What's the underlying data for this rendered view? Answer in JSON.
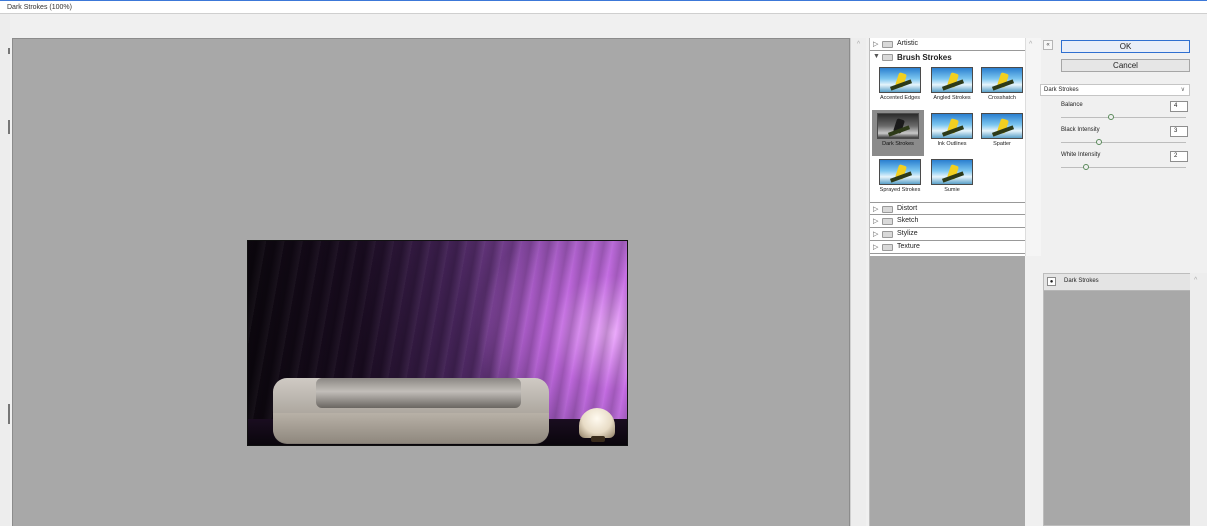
{
  "window": {
    "title": "Dark Strokes (100%)"
  },
  "filter_gallery": {
    "categories_top": [
      {
        "name": "Artistic",
        "expanded": false
      }
    ],
    "open_category": {
      "name": "Brush Strokes",
      "thumbnails": [
        {
          "label": "Accented Edges",
          "selected": false
        },
        {
          "label": "Angled Strokes",
          "selected": false
        },
        {
          "label": "Crosshatch",
          "selected": false
        },
        {
          "label": "Dark Strokes",
          "selected": true
        },
        {
          "label": "Ink Outlines",
          "selected": false
        },
        {
          "label": "Spatter",
          "selected": false
        },
        {
          "label": "Sprayed Strokes",
          "selected": false
        },
        {
          "label": "Sumie",
          "selected": false
        }
      ]
    },
    "categories_bottom": [
      {
        "name": "Distort"
      },
      {
        "name": "Sketch"
      },
      {
        "name": "Stylize"
      },
      {
        "name": "Texture"
      }
    ]
  },
  "buttons": {
    "ok": "OK",
    "cancel": "Cancel"
  },
  "filter_select": {
    "value": "Dark Strokes"
  },
  "parameters": [
    {
      "label": "Balance",
      "value": "4",
      "fraction": 0.4
    },
    {
      "label": "Black Intensity",
      "value": "3",
      "fraction": 0.3
    },
    {
      "label": "White Intensity",
      "value": "2",
      "fraction": 0.2
    }
  ],
  "effect_layers": [
    {
      "name": "Dark Strokes",
      "visible": true
    }
  ],
  "colors": {
    "accent": "#2f6fd0",
    "canvas_bg": "#a8a8a8"
  }
}
